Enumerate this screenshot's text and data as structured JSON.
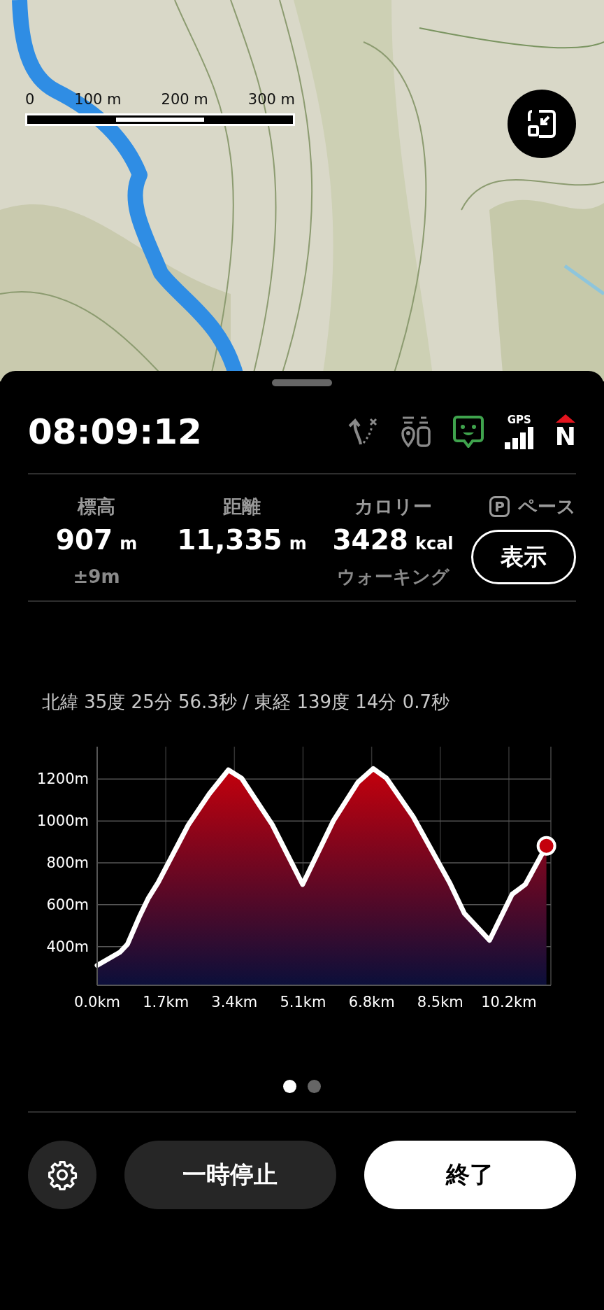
{
  "map": {
    "scale_labels": [
      "0",
      "100 m",
      "200 m",
      "300 m"
    ]
  },
  "header": {
    "time": "08:09:12",
    "status_icons": [
      {
        "kind": "route"
      },
      {
        "kind": "waypoints"
      },
      {
        "kind": "face"
      },
      {
        "kind": "gps",
        "label": "GPS"
      },
      {
        "kind": "compass",
        "label": "N"
      }
    ]
  },
  "stats": [
    {
      "label": "標高",
      "value": "907",
      "unit": "m",
      "sub": "±9m"
    },
    {
      "label": "距離",
      "value": "11,335",
      "unit": "m"
    },
    {
      "label": "カロリー",
      "value": "3428",
      "unit": "kcal",
      "sub": "ウォーキング"
    }
  ],
  "pace": {
    "badge": "P",
    "label": "ペース",
    "button": "表示"
  },
  "coordinates": "北緯 35度 25分 56.3秒 / 東経 139度 14分 0.7秒",
  "chart_data": {
    "type": "area",
    "x": [
      0,
      0.57,
      0.75,
      1.04,
      1.27,
      1.51,
      2.26,
      2.78,
      3.25,
      3.58,
      4.34,
      5.09,
      5.85,
      6.46,
      6.84,
      7.17,
      7.83,
      8.73,
      9.1,
      9.72,
      10.28,
      10.61,
      11.13
    ],
    "grid": true,
    "series": [
      {
        "color": "#c4000c",
        "values": [
          310,
          374,
          411,
          540,
          632,
          706,
          982,
          1130,
          1244,
          1204,
          982,
          697,
          1000,
          1185,
          1250,
          1204,
          1020,
          706,
          558,
          430,
          650,
          697,
          881
        ]
      }
    ],
    "xlim": [
      0,
      11.24
    ],
    "ylim": [
      215,
      1355
    ],
    "xticks": [
      {
        "value": 0,
        "label": "0.0km"
      },
      {
        "value": 1.7,
        "label": "1.7km"
      },
      {
        "value": 3.4,
        "label": "3.4km"
      },
      {
        "value": 5.1,
        "label": "5.1km"
      },
      {
        "value": 6.8,
        "label": "6.8km"
      },
      {
        "value": 8.5,
        "label": "8.5km"
      },
      {
        "value": 10.2,
        "label": "10.2km"
      }
    ],
    "yticks": [
      {
        "value": 400,
        "label": "400m"
      },
      {
        "value": 600,
        "label": "600m"
      },
      {
        "value": 800,
        "label": "800m"
      },
      {
        "value": 1000,
        "label": "1000m"
      },
      {
        "value": 1200,
        "label": "1200m"
      }
    ]
  },
  "pages": [
    {
      "selected": true
    },
    {
      "selected": false
    }
  ],
  "buttons": {
    "pause": "一時停止",
    "end": "終了"
  }
}
